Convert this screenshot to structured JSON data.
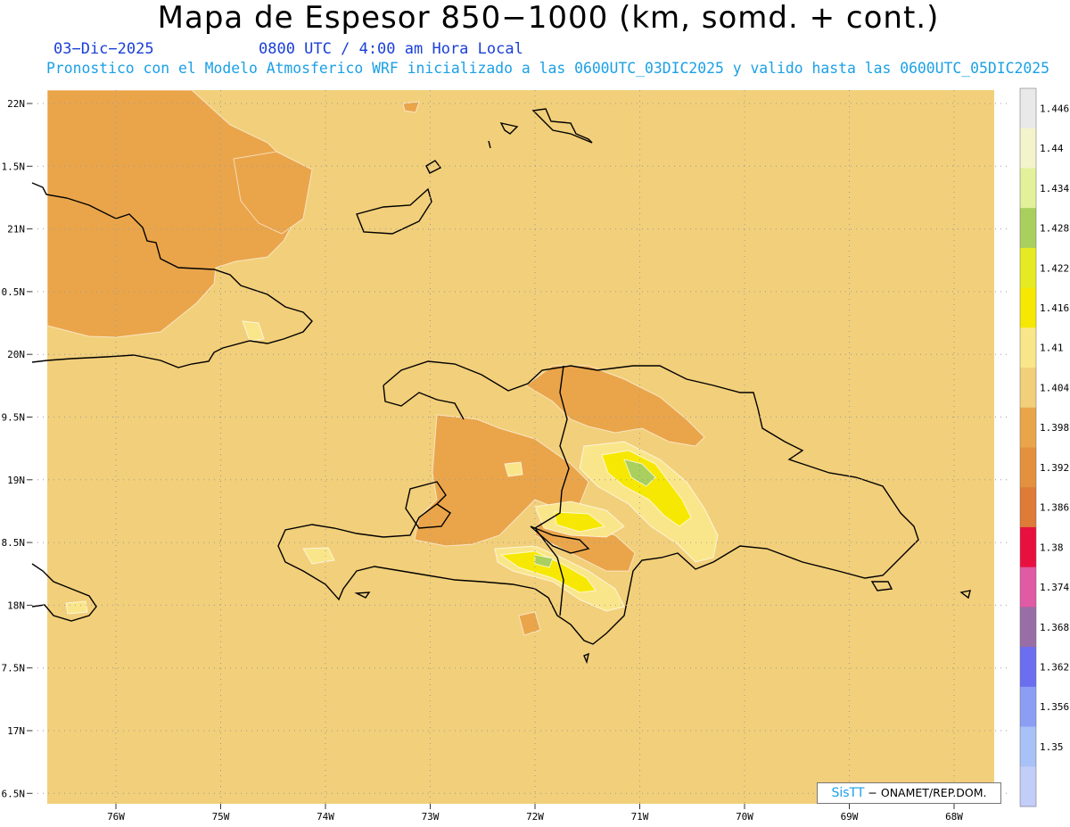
{
  "header": {
    "title": "Mapa de Espesor 850−1000 (km, somd. + cont.)",
    "date": "03−Dic−2025",
    "time": "0800 UTC / 4:00 am Hora Local",
    "subtitle": "Pronostico con el Modelo Atmosferico WRF inicializado a las 0600UTC_03DIC2025 y valido hasta las  0600UTC_05DIC2025"
  },
  "map": {
    "lat_labels": [
      "22N",
      "1.5N",
      "21N",
      "0.5N",
      "20N",
      "9.5N",
      "19N",
      "8.5N",
      "18N",
      "7.5N",
      "17N",
      "6.5N"
    ],
    "lon_labels": [
      "76W",
      "75W",
      "74W",
      "73W",
      "72W",
      "71W",
      "70W",
      "69W",
      "68W"
    ],
    "background_color": "#f2cf7a"
  },
  "colorbar": {
    "labels": [
      "1.446",
      "1.44",
      "1.434",
      "1.428",
      "1.422",
      "1.416",
      "1.41",
      "1.404",
      "1.398",
      "1.392",
      "1.386",
      "1.38",
      "1.374",
      "1.368",
      "1.362",
      "1.356",
      "1.35"
    ],
    "colors": [
      "#e9e9e9",
      "#f3f3cc",
      "#e3f19a",
      "#a9cf5e",
      "#e6ea22",
      "#f6e802",
      "#fae68a",
      "#f2cf7a",
      "#eaa54a",
      "#e3913f",
      "#dd7b37",
      "#e8103e",
      "#e05aa4",
      "#996ea6",
      "#6b6ef0",
      "#8c9ef4",
      "#a8c1f6",
      "#c2cef8"
    ]
  },
  "credit": {
    "sis": "SisTT",
    "org": "− ONAMET/REP.DOM."
  }
}
